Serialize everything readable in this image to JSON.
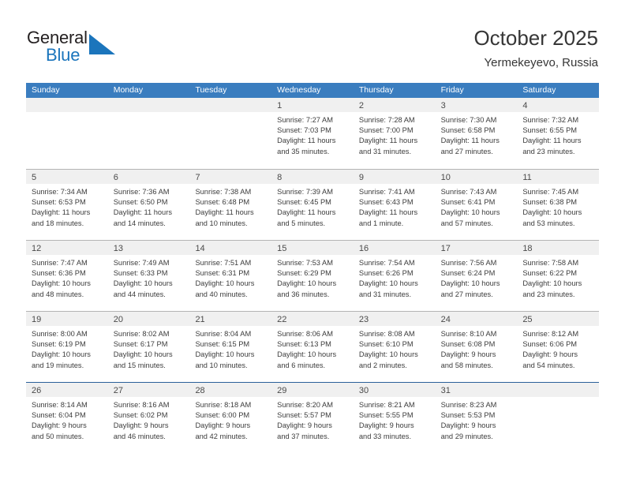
{
  "brand": {
    "name_part1": "General",
    "name_part2": "Blue",
    "logo_icon": "triangle-flag-icon",
    "accent_color": "#1b75bc"
  },
  "header": {
    "title": "October 2025",
    "subtitle": "Yermekeyevo, Russia"
  },
  "theme": {
    "header_row_color": "#3a7dbf",
    "daynum_strip_color": "#f0f0f0",
    "grid_line_color": "#b4b4b4",
    "last_row_line_color": "#2a6099",
    "text_color": "#3c3c3c"
  },
  "weekdays": [
    "Sunday",
    "Monday",
    "Tuesday",
    "Wednesday",
    "Thursday",
    "Friday",
    "Saturday"
  ],
  "labels": {
    "sunrise_prefix": "Sunrise:",
    "sunset_prefix": "Sunset:",
    "daylight_prefix": "Daylight:"
  },
  "weeks": [
    [
      {
        "day": "",
        "empty": true
      },
      {
        "day": "",
        "empty": true
      },
      {
        "day": "",
        "empty": true
      },
      {
        "day": "1",
        "sunrise": "Sunrise: 7:27 AM",
        "sunset": "Sunset: 7:03 PM",
        "daylight_line1": "Daylight: 11 hours",
        "daylight_line2": "and 35 minutes."
      },
      {
        "day": "2",
        "sunrise": "Sunrise: 7:28 AM",
        "sunset": "Sunset: 7:00 PM",
        "daylight_line1": "Daylight: 11 hours",
        "daylight_line2": "and 31 minutes."
      },
      {
        "day": "3",
        "sunrise": "Sunrise: 7:30 AM",
        "sunset": "Sunset: 6:58 PM",
        "daylight_line1": "Daylight: 11 hours",
        "daylight_line2": "and 27 minutes."
      },
      {
        "day": "4",
        "sunrise": "Sunrise: 7:32 AM",
        "sunset": "Sunset: 6:55 PM",
        "daylight_line1": "Daylight: 11 hours",
        "daylight_line2": "and 23 minutes."
      }
    ],
    [
      {
        "day": "5",
        "sunrise": "Sunrise: 7:34 AM",
        "sunset": "Sunset: 6:53 PM",
        "daylight_line1": "Daylight: 11 hours",
        "daylight_line2": "and 18 minutes."
      },
      {
        "day": "6",
        "sunrise": "Sunrise: 7:36 AM",
        "sunset": "Sunset: 6:50 PM",
        "daylight_line1": "Daylight: 11 hours",
        "daylight_line2": "and 14 minutes."
      },
      {
        "day": "7",
        "sunrise": "Sunrise: 7:38 AM",
        "sunset": "Sunset: 6:48 PM",
        "daylight_line1": "Daylight: 11 hours",
        "daylight_line2": "and 10 minutes."
      },
      {
        "day": "8",
        "sunrise": "Sunrise: 7:39 AM",
        "sunset": "Sunset: 6:45 PM",
        "daylight_line1": "Daylight: 11 hours",
        "daylight_line2": "and 5 minutes."
      },
      {
        "day": "9",
        "sunrise": "Sunrise: 7:41 AM",
        "sunset": "Sunset: 6:43 PM",
        "daylight_line1": "Daylight: 11 hours",
        "daylight_line2": "and 1 minute."
      },
      {
        "day": "10",
        "sunrise": "Sunrise: 7:43 AM",
        "sunset": "Sunset: 6:41 PM",
        "daylight_line1": "Daylight: 10 hours",
        "daylight_line2": "and 57 minutes."
      },
      {
        "day": "11",
        "sunrise": "Sunrise: 7:45 AM",
        "sunset": "Sunset: 6:38 PM",
        "daylight_line1": "Daylight: 10 hours",
        "daylight_line2": "and 53 minutes."
      }
    ],
    [
      {
        "day": "12",
        "sunrise": "Sunrise: 7:47 AM",
        "sunset": "Sunset: 6:36 PM",
        "daylight_line1": "Daylight: 10 hours",
        "daylight_line2": "and 48 minutes."
      },
      {
        "day": "13",
        "sunrise": "Sunrise: 7:49 AM",
        "sunset": "Sunset: 6:33 PM",
        "daylight_line1": "Daylight: 10 hours",
        "daylight_line2": "and 44 minutes."
      },
      {
        "day": "14",
        "sunrise": "Sunrise: 7:51 AM",
        "sunset": "Sunset: 6:31 PM",
        "daylight_line1": "Daylight: 10 hours",
        "daylight_line2": "and 40 minutes."
      },
      {
        "day": "15",
        "sunrise": "Sunrise: 7:53 AM",
        "sunset": "Sunset: 6:29 PM",
        "daylight_line1": "Daylight: 10 hours",
        "daylight_line2": "and 36 minutes."
      },
      {
        "day": "16",
        "sunrise": "Sunrise: 7:54 AM",
        "sunset": "Sunset: 6:26 PM",
        "daylight_line1": "Daylight: 10 hours",
        "daylight_line2": "and 31 minutes."
      },
      {
        "day": "17",
        "sunrise": "Sunrise: 7:56 AM",
        "sunset": "Sunset: 6:24 PM",
        "daylight_line1": "Daylight: 10 hours",
        "daylight_line2": "and 27 minutes."
      },
      {
        "day": "18",
        "sunrise": "Sunrise: 7:58 AM",
        "sunset": "Sunset: 6:22 PM",
        "daylight_line1": "Daylight: 10 hours",
        "daylight_line2": "and 23 minutes."
      }
    ],
    [
      {
        "day": "19",
        "sunrise": "Sunrise: 8:00 AM",
        "sunset": "Sunset: 6:19 PM",
        "daylight_line1": "Daylight: 10 hours",
        "daylight_line2": "and 19 minutes."
      },
      {
        "day": "20",
        "sunrise": "Sunrise: 8:02 AM",
        "sunset": "Sunset: 6:17 PM",
        "daylight_line1": "Daylight: 10 hours",
        "daylight_line2": "and 15 minutes."
      },
      {
        "day": "21",
        "sunrise": "Sunrise: 8:04 AM",
        "sunset": "Sunset: 6:15 PM",
        "daylight_line1": "Daylight: 10 hours",
        "daylight_line2": "and 10 minutes."
      },
      {
        "day": "22",
        "sunrise": "Sunrise: 8:06 AM",
        "sunset": "Sunset: 6:13 PM",
        "daylight_line1": "Daylight: 10 hours",
        "daylight_line2": "and 6 minutes."
      },
      {
        "day": "23",
        "sunrise": "Sunrise: 8:08 AM",
        "sunset": "Sunset: 6:10 PM",
        "daylight_line1": "Daylight: 10 hours",
        "daylight_line2": "and 2 minutes."
      },
      {
        "day": "24",
        "sunrise": "Sunrise: 8:10 AM",
        "sunset": "Sunset: 6:08 PM",
        "daylight_line1": "Daylight: 9 hours",
        "daylight_line2": "and 58 minutes."
      },
      {
        "day": "25",
        "sunrise": "Sunrise: 8:12 AM",
        "sunset": "Sunset: 6:06 PM",
        "daylight_line1": "Daylight: 9 hours",
        "daylight_line2": "and 54 minutes."
      }
    ],
    [
      {
        "day": "26",
        "sunrise": "Sunrise: 8:14 AM",
        "sunset": "Sunset: 6:04 PM",
        "daylight_line1": "Daylight: 9 hours",
        "daylight_line2": "and 50 minutes."
      },
      {
        "day": "27",
        "sunrise": "Sunrise: 8:16 AM",
        "sunset": "Sunset: 6:02 PM",
        "daylight_line1": "Daylight: 9 hours",
        "daylight_line2": "and 46 minutes."
      },
      {
        "day": "28",
        "sunrise": "Sunrise: 8:18 AM",
        "sunset": "Sunset: 6:00 PM",
        "daylight_line1": "Daylight: 9 hours",
        "daylight_line2": "and 42 minutes."
      },
      {
        "day": "29",
        "sunrise": "Sunrise: 8:20 AM",
        "sunset": "Sunset: 5:57 PM",
        "daylight_line1": "Daylight: 9 hours",
        "daylight_line2": "and 37 minutes."
      },
      {
        "day": "30",
        "sunrise": "Sunrise: 8:21 AM",
        "sunset": "Sunset: 5:55 PM",
        "daylight_line1": "Daylight: 9 hours",
        "daylight_line2": "and 33 minutes."
      },
      {
        "day": "31",
        "sunrise": "Sunrise: 8:23 AM",
        "sunset": "Sunset: 5:53 PM",
        "daylight_line1": "Daylight: 9 hours",
        "daylight_line2": "and 29 minutes."
      },
      {
        "day": "",
        "empty": true
      }
    ]
  ]
}
